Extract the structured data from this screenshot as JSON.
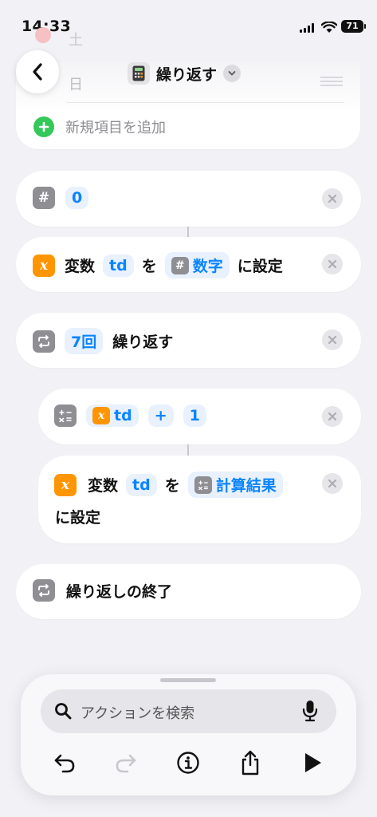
{
  "status_bar": {
    "time": "14:33",
    "battery": "71"
  },
  "header": {
    "title": "繰り返す",
    "bg_items": [
      "土",
      "日"
    ]
  },
  "add_item": {
    "label": "新規項目を追加"
  },
  "actions": {
    "number": {
      "value": "0"
    },
    "set_var1": {
      "prefix": "変数",
      "var": "td",
      "particle": "を",
      "source": "数字",
      "suffix": "に設定"
    },
    "repeat": {
      "count": "7回",
      "label": "繰り返す"
    },
    "calc": {
      "var": "td",
      "op": "+",
      "operand": "1"
    },
    "set_var2": {
      "prefix": "変数",
      "var": "td",
      "particle": "を",
      "source": "計算結果",
      "suffix": "に設定"
    },
    "end_repeat": {
      "label": "繰り返しの終了"
    }
  },
  "search": {
    "placeholder": "アクションを検索"
  },
  "icons": [
    "back-icon",
    "calculator-icon",
    "chevron-down-icon",
    "plus-icon",
    "hash-icon",
    "variable-icon",
    "repeat-icon",
    "calc-icon",
    "remove-icon",
    "search-icon",
    "mic-icon",
    "undo-icon",
    "redo-icon",
    "info-icon",
    "share-icon",
    "play-icon"
  ],
  "colors": {
    "accent": "#0a84ff",
    "green": "#34c759",
    "orange": "#ff9500",
    "gray": "#8e8e93"
  }
}
